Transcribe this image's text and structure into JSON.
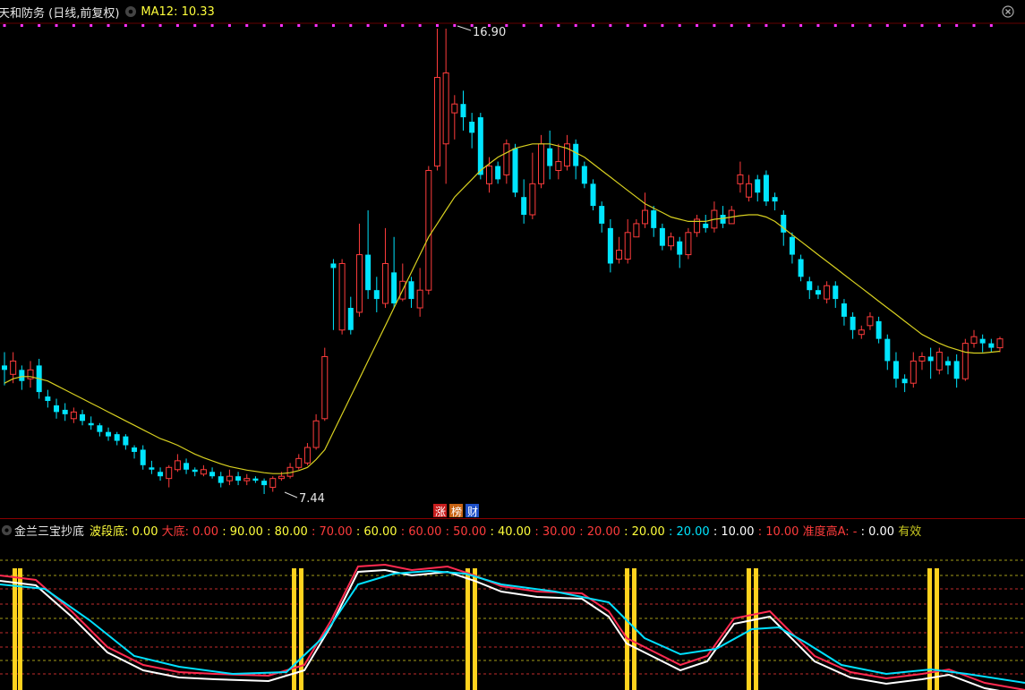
{
  "header": {
    "title": "天和防务 (日线,前复权)",
    "ma_label": "MA12: 10.33",
    "ma_color": "#ffff3c"
  },
  "indicator": {
    "name": "金兰三宝抄底",
    "params": [
      {
        "t": "波段底: 0.00",
        "c": "#ffff3c"
      },
      {
        "t": "大底: 0.00",
        "c": "#ff3c3c"
      },
      {
        "t": ": 90.00",
        "c": "#ffff3c"
      },
      {
        "t": ": 80.00",
        "c": "#ffff3c"
      },
      {
        "t": ": 70.00",
        "c": "#ff3c3c"
      },
      {
        "t": ": 60.00",
        "c": "#ffff3c"
      },
      {
        "t": ": 60.00",
        "c": "#ff3c3c"
      },
      {
        "t": ": 50.00",
        "c": "#ff3c3c"
      },
      {
        "t": ": 40.00",
        "c": "#ffff3c"
      },
      {
        "t": ": 30.00",
        "c": "#ff3c3c"
      },
      {
        "t": ": 20.00",
        "c": "#ff3c3c"
      },
      {
        "t": ": 20.00",
        "c": "#ffff3c"
      },
      {
        "t": ": 20.00",
        "c": "#00e5ff"
      },
      {
        "t": ": 10.00",
        "c": "#ffffff"
      },
      {
        "t": ": 10.00",
        "c": "#ff3c3c"
      },
      {
        "t": "准度高A: -",
        "c": "#ff3c3c"
      },
      {
        "t": ": 0.00",
        "c": "#ffffff"
      },
      {
        "t": "有效",
        "c": "#c8c820"
      }
    ]
  },
  "badges": [
    {
      "t": "涨",
      "bg": "#c81e1e"
    },
    {
      "t": "榜",
      "bg": "#c86414"
    },
    {
      "t": "财",
      "bg": "#1e50c8"
    }
  ],
  "chart_data": {
    "type": "candlestick",
    "price_annotations": {
      "high": "16.90",
      "low": "7.44"
    },
    "candles": [
      [
        9.3,
        9.2,
        9.6,
        8.85
      ],
      [
        9.1,
        9.4,
        9.6,
        8.9
      ],
      [
        9.2,
        8.95,
        9.3,
        8.75
      ],
      [
        9.0,
        9.2,
        9.4,
        8.8
      ],
      [
        9.3,
        8.7,
        9.45,
        8.55
      ],
      [
        8.6,
        8.5,
        8.75,
        8.35
      ],
      [
        8.4,
        8.25,
        8.55,
        8.1
      ],
      [
        8.3,
        8.2,
        8.45,
        8.05
      ],
      [
        8.1,
        8.25,
        8.35,
        8.0
      ],
      [
        8.2,
        8.05,
        8.3,
        7.95
      ],
      [
        8.0,
        7.95,
        8.15,
        7.85
      ],
      [
        7.95,
        7.8,
        8.0,
        7.7
      ],
      [
        7.8,
        7.7,
        7.9,
        7.6
      ],
      [
        7.75,
        7.6,
        7.8,
        7.5
      ],
      [
        7.7,
        7.5,
        7.75,
        7.4
      ],
      [
        7.45,
        7.35,
        7.5,
        7.2
      ],
      [
        7.4,
        7.05,
        7.5,
        6.95
      ],
      [
        7.0,
        6.95,
        7.15,
        6.85
      ],
      [
        6.9,
        6.8,
        7.0,
        6.7
      ],
      [
        6.75,
        7.0,
        7.05,
        6.55
      ],
      [
        6.95,
        7.15,
        7.3,
        6.9
      ],
      [
        7.1,
        6.95,
        7.2,
        6.85
      ],
      [
        6.95,
        6.9,
        7.0,
        6.8
      ],
      [
        6.85,
        6.95,
        7.05,
        6.8
      ],
      [
        6.9,
        6.8,
        7.0,
        6.75
      ],
      [
        6.8,
        6.65,
        6.9,
        6.55
      ],
      [
        6.7,
        6.8,
        6.95,
        6.6
      ],
      [
        6.8,
        6.7,
        6.9,
        6.6
      ],
      [
        6.7,
        6.75,
        6.85,
        6.6
      ],
      [
        6.75,
        6.7,
        6.8,
        6.65
      ],
      [
        6.7,
        6.6,
        6.75,
        6.4
      ],
      [
        6.55,
        6.75,
        6.8,
        6.45
      ],
      [
        6.75,
        6.8,
        6.9,
        6.7
      ],
      [
        6.8,
        7.0,
        7.1,
        6.75
      ],
      [
        7.0,
        7.2,
        7.3,
        6.95
      ],
      [
        7.1,
        7.45,
        7.55,
        7.05
      ],
      [
        7.45,
        8.05,
        8.2,
        7.4
      ],
      [
        8.1,
        9.5,
        9.7,
        8.05
      ],
      [
        11.6,
        11.5,
        11.7,
        10.1
      ],
      [
        10.1,
        11.6,
        11.7,
        10.0
      ],
      [
        10.6,
        10.1,
        10.85,
        10.0
      ],
      [
        10.5,
        11.8,
        12.5,
        10.4
      ],
      [
        11.8,
        11.0,
        12.8,
        10.8
      ],
      [
        11.0,
        10.8,
        11.3,
        10.5
      ],
      [
        10.7,
        11.6,
        12.4,
        10.6
      ],
      [
        11.4,
        10.7,
        12.2,
        10.6
      ],
      [
        10.8,
        11.2,
        11.6,
        10.75
      ],
      [
        11.2,
        10.8,
        11.3,
        10.6
      ],
      [
        10.6,
        11.0,
        11.5,
        10.4
      ],
      [
        11.0,
        13.7,
        13.8,
        10.9
      ],
      [
        13.8,
        15.8,
        16.9,
        13.7
      ],
      [
        14.3,
        15.9,
        16.9,
        13.4
      ],
      [
        15.0,
        15.2,
        15.4,
        14.4
      ],
      [
        15.2,
        14.9,
        15.5,
        14.6
      ],
      [
        14.8,
        14.55,
        15.0,
        14.2
      ],
      [
        14.9,
        13.6,
        15.0,
        13.5
      ],
      [
        13.4,
        13.8,
        14.0,
        13.2
      ],
      [
        13.8,
        13.5,
        13.9,
        13.4
      ],
      [
        13.6,
        14.3,
        14.4,
        13.4
      ],
      [
        14.2,
        13.2,
        14.3,
        13.1
      ],
      [
        13.1,
        12.7,
        13.5,
        12.5
      ],
      [
        12.7,
        13.4,
        14.1,
        12.6
      ],
      [
        13.4,
        14.3,
        14.5,
        13.3
      ],
      [
        14.2,
        13.8,
        14.6,
        13.5
      ],
      [
        13.7,
        13.9,
        14.3,
        13.5
      ],
      [
        13.8,
        14.3,
        14.5,
        13.7
      ],
      [
        14.3,
        13.8,
        14.4,
        13.5
      ],
      [
        13.8,
        13.4,
        13.9,
        13.3
      ],
      [
        13.4,
        12.9,
        13.5,
        12.8
      ],
      [
        12.9,
        12.5,
        13.0,
        12.3
      ],
      [
        12.4,
        11.6,
        12.6,
        11.4
      ],
      [
        11.7,
        11.9,
        12.2,
        11.6
      ],
      [
        11.7,
        12.3,
        12.6,
        11.6
      ],
      [
        12.2,
        12.5,
        12.6,
        12.2
      ],
      [
        12.5,
        12.8,
        13.2,
        12.4
      ],
      [
        12.8,
        12.4,
        12.9,
        12.2
      ],
      [
        12.4,
        12.0,
        12.5,
        11.9
      ],
      [
        12.0,
        12.2,
        12.3,
        11.9
      ],
      [
        12.1,
        11.8,
        12.2,
        11.5
      ],
      [
        11.8,
        12.3,
        12.4,
        11.7
      ],
      [
        12.3,
        12.6,
        12.7,
        12.2
      ],
      [
        12.5,
        12.4,
        12.7,
        12.3
      ],
      [
        12.4,
        12.8,
        13.0,
        12.3
      ],
      [
        12.7,
        12.5,
        12.9,
        12.4
      ],
      [
        12.5,
        12.8,
        12.9,
        12.5
      ],
      [
        13.4,
        13.6,
        13.9,
        13.2
      ],
      [
        13.1,
        13.4,
        13.6,
        13.0
      ],
      [
        13.5,
        13.2,
        13.6,
        13.0
      ],
      [
        13.6,
        13.0,
        13.7,
        12.9
      ],
      [
        13.1,
        13.0,
        13.2,
        12.8
      ],
      [
        12.7,
        12.3,
        12.8,
        12.0
      ],
      [
        12.2,
        11.8,
        12.3,
        11.6
      ],
      [
        11.7,
        11.3,
        11.8,
        11.2
      ],
      [
        11.2,
        11.0,
        11.3,
        10.8
      ],
      [
        11.0,
        10.9,
        11.1,
        10.8
      ],
      [
        10.8,
        11.1,
        11.2,
        10.7
      ],
      [
        11.1,
        10.8,
        11.2,
        10.6
      ],
      [
        10.7,
        10.4,
        10.8,
        10.2
      ],
      [
        10.4,
        10.1,
        10.5,
        9.9
      ],
      [
        10.0,
        10.1,
        10.2,
        9.9
      ],
      [
        10.2,
        10.4,
        10.5,
        10.1
      ],
      [
        10.3,
        9.9,
        10.4,
        9.8
      ],
      [
        9.9,
        9.4,
        10.0,
        9.2
      ],
      [
        9.4,
        9.0,
        9.6,
        8.8
      ],
      [
        9.0,
        8.9,
        9.1,
        8.7
      ],
      [
        8.9,
        9.4,
        9.6,
        8.8
      ],
      [
        9.4,
        9.5,
        9.6,
        9.2
      ],
      [
        9.5,
        9.4,
        9.7,
        9.0
      ],
      [
        9.2,
        9.6,
        9.7,
        9.1
      ],
      [
        9.4,
        9.3,
        9.5,
        9.1
      ],
      [
        9.4,
        9.0,
        9.55,
        8.8
      ],
      [
        9.0,
        9.8,
        9.9,
        8.95
      ],
      [
        9.8,
        9.95,
        10.1,
        9.7
      ],
      [
        9.9,
        9.8,
        10.0,
        9.6
      ],
      [
        9.8,
        9.7,
        9.9,
        9.6
      ],
      [
        9.7,
        9.9,
        9.95,
        9.6
      ]
    ],
    "ma12": [
      8.9,
      9.0,
      9.05,
      9.05,
      9.0,
      8.95,
      8.85,
      8.75,
      8.65,
      8.55,
      8.45,
      8.35,
      8.25,
      8.15,
      8.05,
      7.95,
      7.85,
      7.75,
      7.65,
      7.58,
      7.5,
      7.4,
      7.3,
      7.22,
      7.15,
      7.08,
      7.02,
      6.98,
      6.94,
      6.91,
      6.88,
      6.86,
      6.86,
      6.88,
      6.93,
      7.0,
      7.18,
      7.4,
      7.8,
      8.2,
      8.6,
      9.0,
      9.4,
      9.8,
      10.2,
      10.6,
      11.0,
      11.4,
      11.8,
      12.2,
      12.5,
      12.8,
      13.1,
      13.3,
      13.5,
      13.7,
      13.85,
      14.0,
      14.1,
      14.2,
      14.25,
      14.3,
      14.3,
      14.3,
      14.25,
      14.2,
      14.1,
      14.0,
      13.85,
      13.7,
      13.55,
      13.4,
      13.25,
      13.1,
      12.95,
      12.85,
      12.75,
      12.65,
      12.6,
      12.55,
      12.55,
      12.55,
      12.6,
      12.62,
      12.65,
      12.68,
      12.7,
      12.7,
      12.65,
      12.55,
      12.4,
      12.25,
      12.1,
      11.95,
      11.8,
      11.65,
      11.5,
      11.35,
      11.2,
      11.05,
      10.9,
      10.75,
      10.6,
      10.45,
      10.3,
      10.15,
      10.0,
      9.9,
      9.8,
      9.72,
      9.66,
      9.6,
      9.58,
      9.58,
      9.6,
      9.62
    ]
  }
}
